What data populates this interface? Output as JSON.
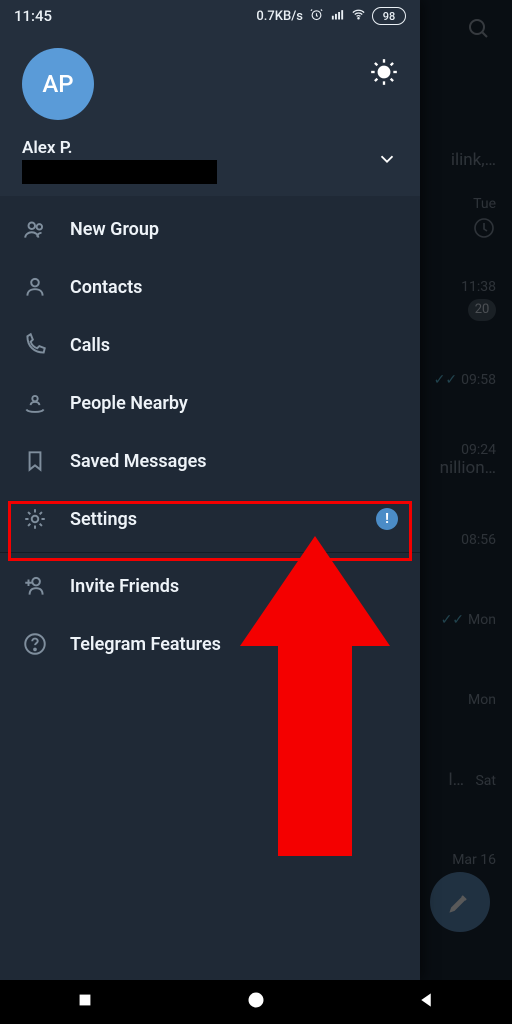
{
  "statusbar": {
    "time": "11:45",
    "speed": "0.7KB/s",
    "battery": "98"
  },
  "profile": {
    "initials": "AP",
    "name": "Alex P."
  },
  "menu": {
    "new_group": "New Group",
    "contacts": "Contacts",
    "calls": "Calls",
    "people_nearby": "People Nearby",
    "saved_messages": "Saved Messages",
    "settings": "Settings",
    "settings_badge": "!",
    "invite_friends": "Invite Friends",
    "telegram_features": "Telegram Features"
  },
  "chats": {
    "c0_snip": "ilink,…",
    "c0_time": "Tue",
    "c1_time": "11:38",
    "c1_badge": "20",
    "c2_time": "09:58",
    "c3_snip": "nillion…",
    "c3_time": "09:24",
    "c4_time": "08:56",
    "c5_time": "Mon",
    "c6_time": "Mon",
    "c7_snip": "l…",
    "c7_time": "Sat",
    "c8_time": "Mar 16"
  }
}
